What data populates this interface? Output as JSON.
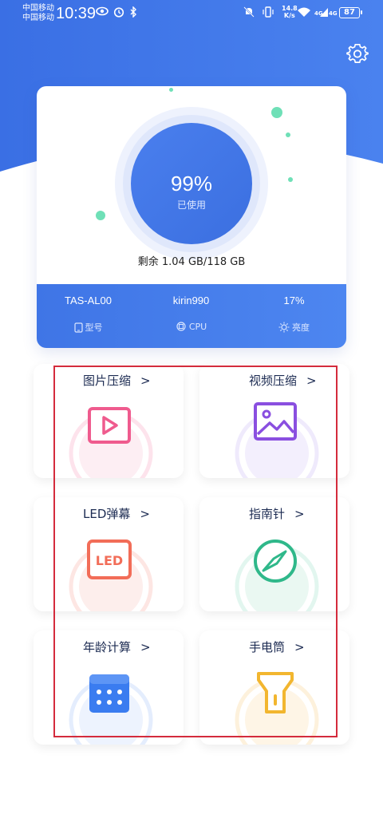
{
  "status_bar": {
    "carrier_1": "中国移动",
    "carrier_2": "中国移动",
    "time": "10:39",
    "net_speed": "14.8",
    "net_unit": "K/s",
    "signal_1": "4G",
    "signal_2": "4G",
    "battery": "87"
  },
  "storage": {
    "percent": "99%",
    "used_label": "已使用",
    "remaining": "剩余 1.04 GB/118 GB"
  },
  "stats": [
    {
      "value": "TAS-AL00",
      "label": "型号",
      "icon": "phone-icon"
    },
    {
      "value": "kirin990",
      "label": "CPU",
      "icon": "chip-icon"
    },
    {
      "value": "17%",
      "label": "亮度",
      "icon": "sun-icon"
    }
  ],
  "tiles": [
    {
      "label": "图片压缩",
      "icon": "play-icon",
      "color": "#ef5b8e"
    },
    {
      "label": "视频压缩",
      "icon": "image-icon",
      "color": "#8a4fe0"
    },
    {
      "label": "LED弹幕",
      "icon": "led-icon",
      "color": "#f26d58"
    },
    {
      "label": "指南针",
      "icon": "compass-icon",
      "color": "#2fb88a"
    },
    {
      "label": "年龄计算",
      "icon": "calculator-icon",
      "color": "#3a7cf0"
    },
    {
      "label": "手电筒",
      "icon": "flashlight-icon",
      "color": "#f2b62f"
    }
  ],
  "chevron": ">",
  "colors": {
    "header_blue": "#3f74e8",
    "highlight_red": "#d42b3c"
  }
}
